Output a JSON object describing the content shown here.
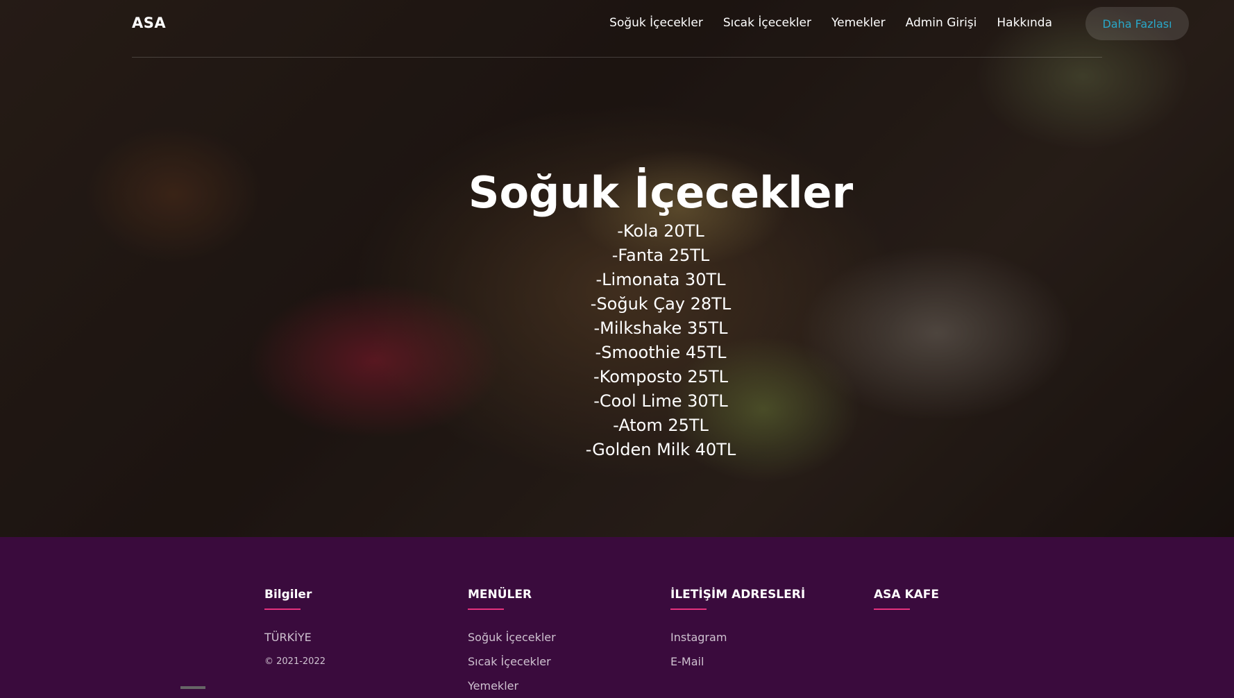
{
  "nav": {
    "brand": "ASA",
    "links": [
      "Soğuk İçecekler",
      "Sıcak İçecekler",
      "Yemekler",
      "Admin Girişi",
      "Hakkında"
    ],
    "more_label": "Daha Fazlası"
  },
  "hero": {
    "title": "Soğuk İçecekler",
    "items": [
      "-Kola 20TL",
      "-Fanta 25TL",
      "-Limonata 30TL",
      "-Soğuk Çay 28TL",
      "-Milkshake 35TL",
      "-Smoothie 45TL",
      "-Komposto 25TL",
      "-Cool Lime 30TL",
      "-Atom 25TL",
      "-Golden Milk 40TL"
    ]
  },
  "footer": {
    "info": {
      "title": "Bilgiler",
      "country": "TÜRKİYE",
      "copyright": "© 2021-2022"
    },
    "menus": {
      "title": "MENÜLER",
      "items": [
        "Soğuk İçecekler",
        "Sıcak İçecekler",
        "Yemekler"
      ]
    },
    "contact": {
      "title": "İLETİŞİM ADRESLERİ",
      "items": [
        "Instagram",
        "E-Mail"
      ]
    },
    "brand_col": {
      "title": "ASA KAFE"
    }
  },
  "colors": {
    "footer_bg": "#3a0b3d",
    "accent_underline": "#e6327e",
    "button_text": "#29a8c9"
  }
}
